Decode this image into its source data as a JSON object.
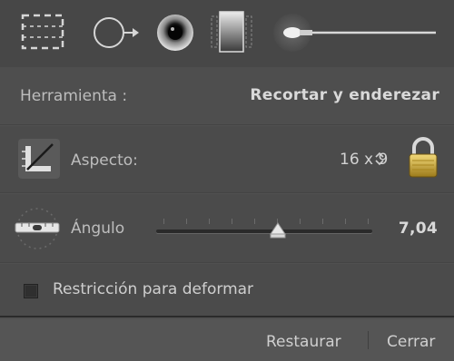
{
  "toolstrip": {
    "tools": [
      {
        "name": "crop-overlay-tool",
        "icon": "dashed-rectangle-icon"
      },
      {
        "name": "spot-removal-tool",
        "icon": "circle-arrow-icon"
      },
      {
        "name": "red-eye-tool",
        "icon": "eye-icon"
      },
      {
        "name": "graduated-filter-tool",
        "icon": "gradient-filter-icon"
      },
      {
        "name": "adjustment-brush-tool",
        "icon": "brush-icon"
      }
    ]
  },
  "header": {
    "tool_label": "Herramienta :",
    "tool_name": "Recortar y enderezar"
  },
  "aspect": {
    "icon": "crop-angle-icon",
    "label": "Aspecto:",
    "value": "16 x 9",
    "stepper_icon": "up-down-chevron-icon",
    "lock_icon": "padlock-icon"
  },
  "angle": {
    "icon": "level-tool-icon",
    "label": "Ángulo",
    "value": "7,04"
  },
  "constraint": {
    "checkbox_label": "Restricción para deformar",
    "checked": false
  },
  "footer": {
    "reset_label": "Restaurar",
    "close_label": "Cerrar"
  },
  "colors": {
    "panel_bg": "#505050",
    "toolstrip_bg": "#474747",
    "text": "#cfcfcf",
    "lock_gold": "#c9a43a"
  }
}
